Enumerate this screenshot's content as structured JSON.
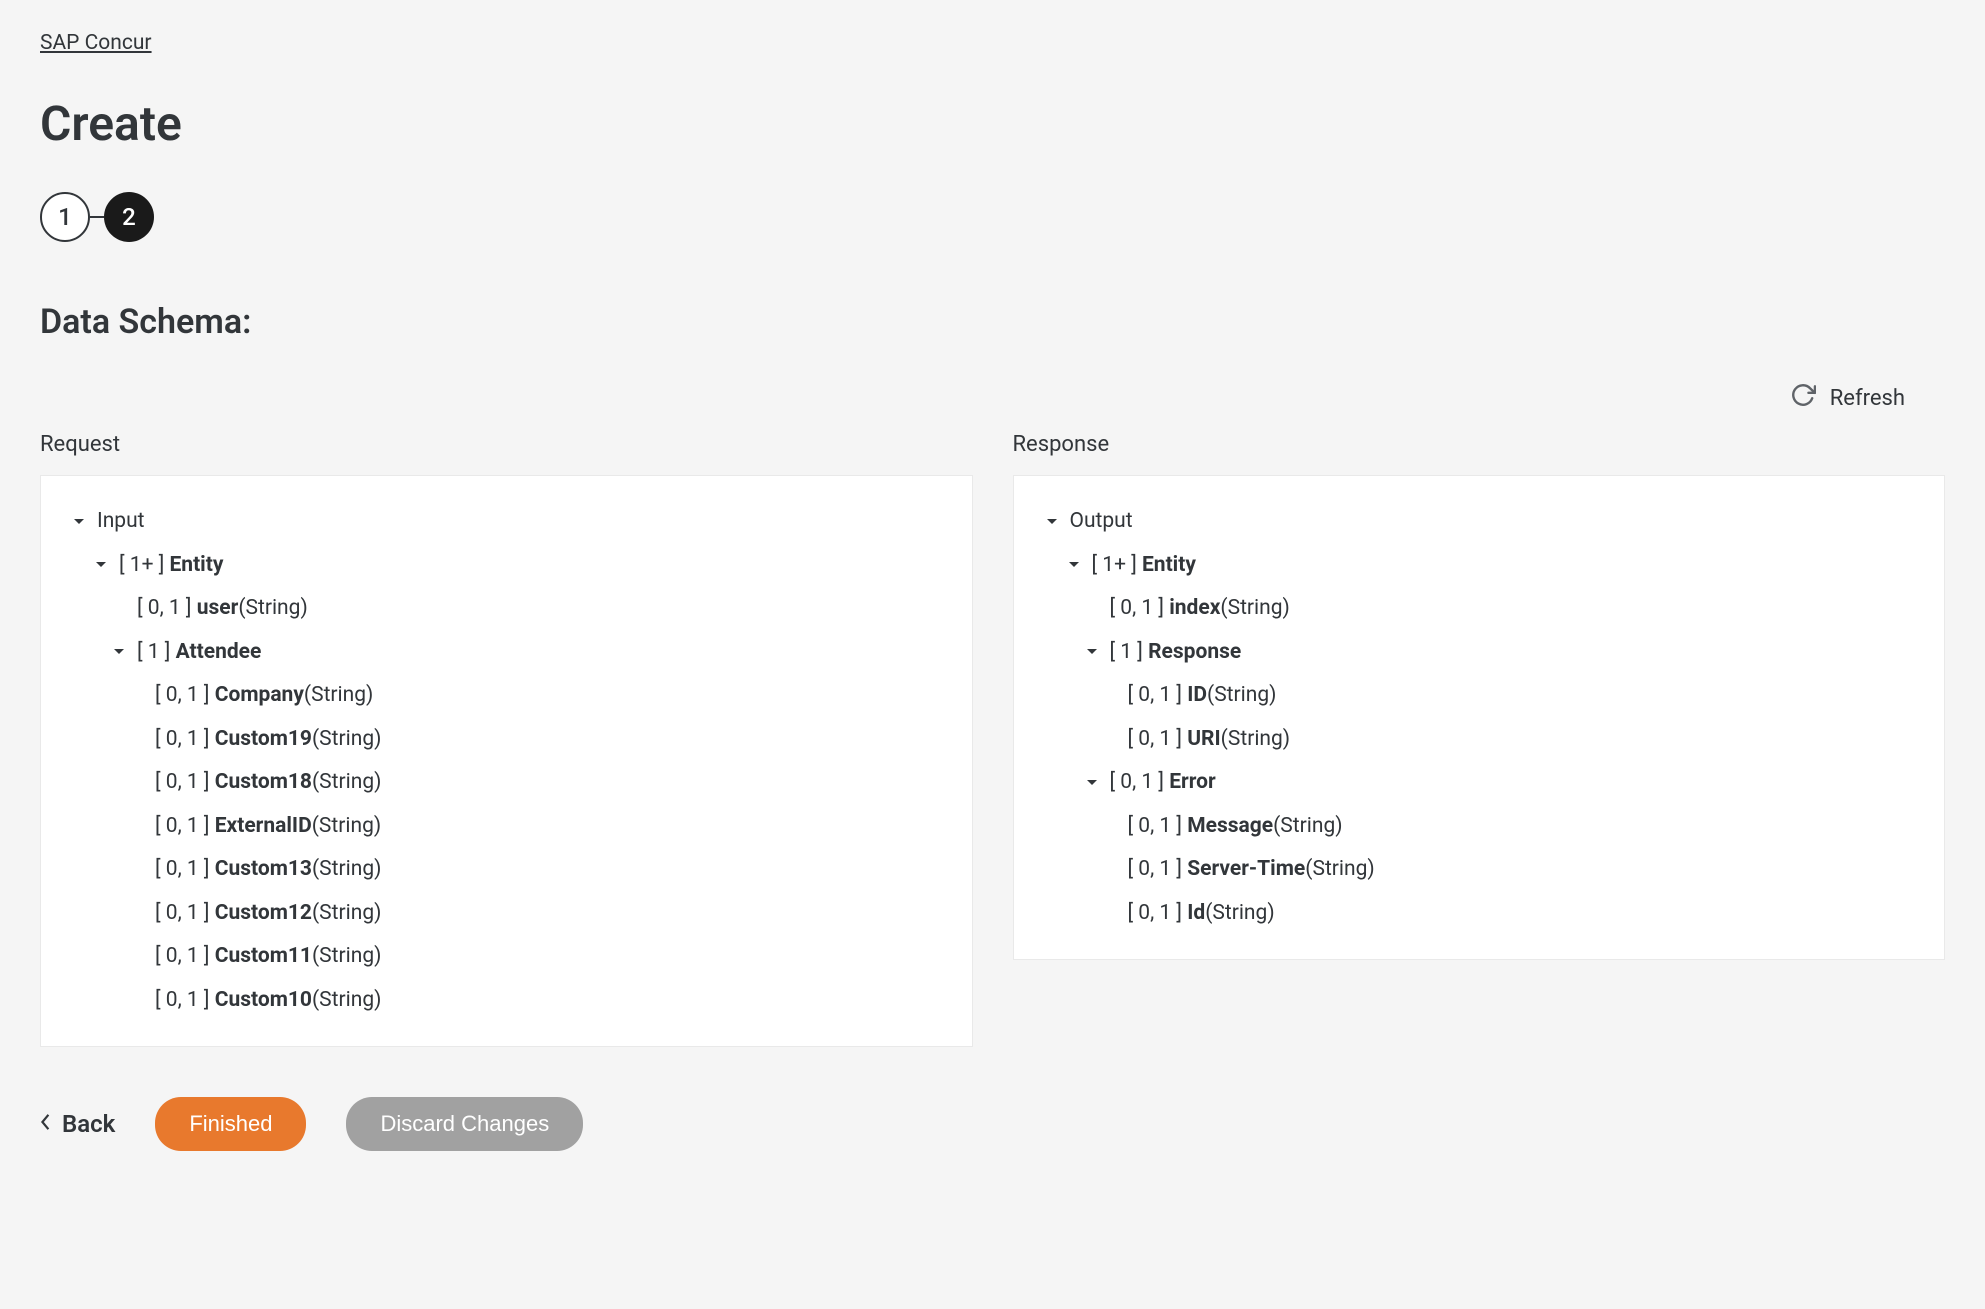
{
  "breadcrumb": "SAP Concur",
  "page_title": "Create",
  "stepper": {
    "step1": "1",
    "step2": "2"
  },
  "section_title": "Data Schema:",
  "refresh_label": "Refresh",
  "request_label": "Request",
  "response_label": "Response",
  "request_tree": [
    {
      "level": 0,
      "chevron": true,
      "label": "Input"
    },
    {
      "level": 1,
      "chevron": true,
      "cardinality": "[ 1+ ]",
      "name": "Entity"
    },
    {
      "level": 2,
      "chevron": false,
      "cardinality": "[ 0, 1 ]",
      "name": "user",
      "type": "(String)"
    },
    {
      "level": 2,
      "chevron": true,
      "cardinality": "[ 1 ]",
      "name": "Attendee"
    },
    {
      "level": 3,
      "chevron": false,
      "cardinality": "[ 0, 1 ]",
      "name": "Company",
      "type": "(String)"
    },
    {
      "level": 3,
      "chevron": false,
      "cardinality": "[ 0, 1 ]",
      "name": "Custom19",
      "type": "(String)"
    },
    {
      "level": 3,
      "chevron": false,
      "cardinality": "[ 0, 1 ]",
      "name": "Custom18",
      "type": "(String)"
    },
    {
      "level": 3,
      "chevron": false,
      "cardinality": "[ 0, 1 ]",
      "name": "ExternalID",
      "type": "(String)"
    },
    {
      "level": 3,
      "chevron": false,
      "cardinality": "[ 0, 1 ]",
      "name": "Custom13",
      "type": "(String)"
    },
    {
      "level": 3,
      "chevron": false,
      "cardinality": "[ 0, 1 ]",
      "name": "Custom12",
      "type": "(String)"
    },
    {
      "level": 3,
      "chevron": false,
      "cardinality": "[ 0, 1 ]",
      "name": "Custom11",
      "type": "(String)"
    },
    {
      "level": 3,
      "chevron": false,
      "cardinality": "[ 0, 1 ]",
      "name": "Custom10",
      "type": "(String)"
    }
  ],
  "response_tree": [
    {
      "level": 0,
      "chevron": true,
      "label": "Output"
    },
    {
      "level": 1,
      "chevron": true,
      "cardinality": "[ 1+ ]",
      "name": "Entity"
    },
    {
      "level": 2,
      "chevron": false,
      "cardinality": "[ 0, 1 ]",
      "name": "index",
      "type": "(String)"
    },
    {
      "level": 2,
      "chevron": true,
      "cardinality": "[ 1 ]",
      "name": "Response"
    },
    {
      "level": 3,
      "chevron": false,
      "cardinality": "[ 0, 1 ]",
      "name": "ID",
      "type": "(String)"
    },
    {
      "level": 3,
      "chevron": false,
      "cardinality": "[ 0, 1 ]",
      "name": "URI",
      "type": "(String)"
    },
    {
      "level": 2,
      "chevron": true,
      "cardinality": "[ 0, 1 ]",
      "name": "Error"
    },
    {
      "level": 3,
      "chevron": false,
      "cardinality": "[ 0, 1 ]",
      "name": "Message",
      "type": "(String)"
    },
    {
      "level": 3,
      "chevron": false,
      "cardinality": "[ 0, 1 ]",
      "name": "Server-Time",
      "type": "(String)"
    },
    {
      "level": 3,
      "chevron": false,
      "cardinality": "[ 0, 1 ]",
      "name": "Id",
      "type": "(String)"
    }
  ],
  "footer": {
    "back": "Back",
    "finished": "Finished",
    "discard": "Discard Changes"
  }
}
